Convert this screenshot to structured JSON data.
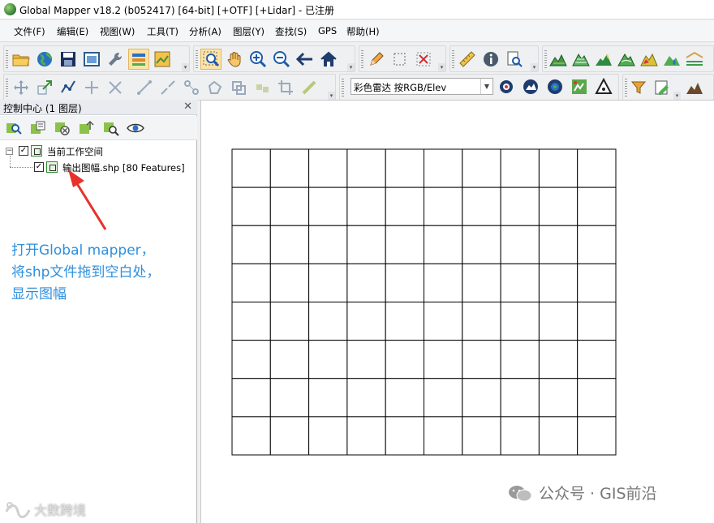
{
  "window": {
    "title": "Global Mapper v18.2 (b052417) [64-bit] [+OTF] [+Lidar] - 已注册"
  },
  "menu": [
    "文件(F)",
    "编辑(E)",
    "视图(W)",
    "工具(T)",
    "分析(A)",
    "图层(Y)",
    "查找(S)",
    "GPS",
    "帮助(H)"
  ],
  "toolbar": {
    "shader_select": {
      "value": "彩色雷达 按RGB/Elev"
    }
  },
  "control_center": {
    "title": "控制中心 (1 图层)",
    "tree": {
      "workspace": {
        "label": "当前工作空间",
        "checked": true
      },
      "layer": {
        "label": "输出图幅.shp [80 Features]",
        "checked": true
      }
    }
  },
  "annotation": {
    "lines": [
      "打开Global mapper，",
      "将shp文件拖到空白处，",
      "显示图幅"
    ],
    "color": "#2f8fdc"
  },
  "map": {
    "grid": {
      "columns": 10,
      "rows": 8
    }
  },
  "watermarks": {
    "left": "大数跨境",
    "right": "公众号 · GIS前沿"
  }
}
